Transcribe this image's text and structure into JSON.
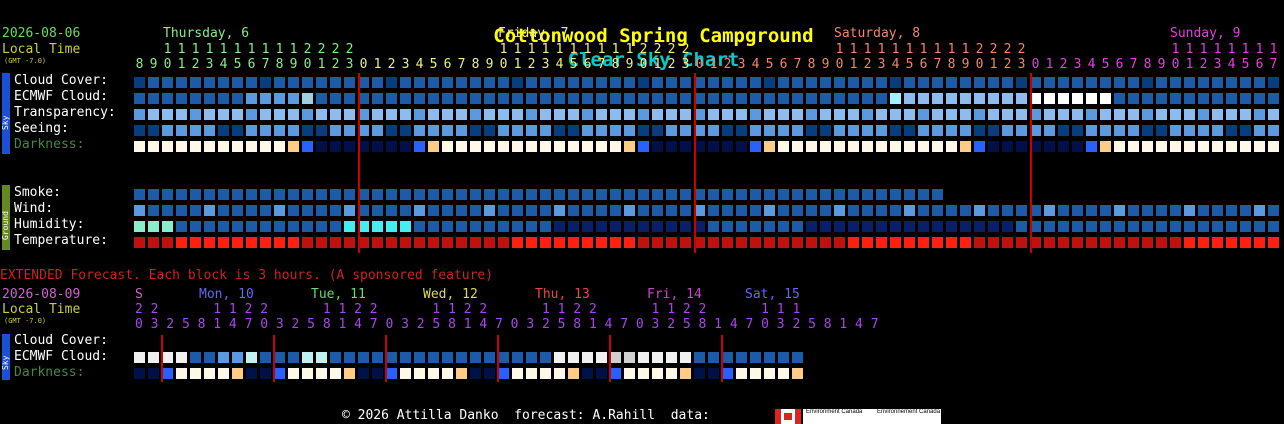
{
  "title": {
    "part1": "Cottonwood Spring Campground",
    "part2": "Clear Sky Chart"
  },
  "colors": {
    "title1": "#ffff00",
    "title2": "#00cccc",
    "date": "#66dd66",
    "local": "#cccc44",
    "label": "#ffffff",
    "darkness_label": "#448844",
    "extended": "#cc2222",
    "vline": "#cc0000"
  },
  "main": {
    "date": "2026-08-06",
    "local_time": "Local Time",
    "gmt": "(GMT -7.0)",
    "days": [
      {
        "label": "Thursday, 6",
        "color": "#88ee88"
      },
      {
        "label": "Friday, 7",
        "color": "#eeee88"
      },
      {
        "label": "Saturday, 8",
        "color": "#ee8866"
      },
      {
        "label": "Sunday, 9",
        "color": "#dd44dd"
      }
    ],
    "hours_row1": "                     1 1 1 1 1 1 1 1 1 1 1 2 2 2 2",
    "hours_row2": "8 9 0 1 2 3 4 5 6 7 8 9 0 1 2 3 0 1 2 3",
    "sky_labels": [
      "Cloud Cover:",
      "ECMWF Cloud:",
      "Transparency:",
      "Seeing:",
      "Darkness:"
    ],
    "ground_labels": [
      "Smoke:",
      "Wind:",
      "Humidity:",
      "Temperature:"
    ],
    "sky_side": "Sky",
    "ground_side": "Ground"
  },
  "extended": {
    "banner": "EXTENDED Forecast. Each block is 3 hours. (A sponsored feature)",
    "date": "2026-08-09",
    "local_time": "Local Time",
    "gmt": "(GMT -7.0)",
    "days": [
      {
        "label": "S",
        "color": "#cc66cc"
      },
      {
        "label": "Mon, 10",
        "color": "#6666ee"
      },
      {
        "label": "Tue, 11",
        "color": "#66dd66"
      },
      {
        "label": "Wed, 12",
        "color": "#dddd44"
      },
      {
        "label": "Thu, 13",
        "color": "#ee4444"
      },
      {
        "label": "Fri, 14",
        "color": "#cc44cc"
      },
      {
        "label": "Sat, 15",
        "color": "#6666ee"
      }
    ],
    "hours_tens": "2 2       1 1 2 2       1 1 2 2       1 1 2 2       1 1 2 2       1 1 2 2       1 1 1",
    "hours_units": "0 3 2 5 8 1 4 7 0 3 2 5 8 1 4 7 0 3 2 5 8 1 4 7 0 3 2 5 8 1 4 7 0 3 2 5 8 1 4 7 0 3 2 5 8 1 4 7",
    "sky_labels": [
      "Cloud Cover:",
      "ECMWF Cloud:",
      "Darkness:"
    ],
    "sky_side": "Sky"
  },
  "footer": {
    "text": "© 2026 Attilla Danko  forecast: A.Rahill  data:",
    "env1": "Environment Canada",
    "env2": "Environnement Canada"
  }
}
